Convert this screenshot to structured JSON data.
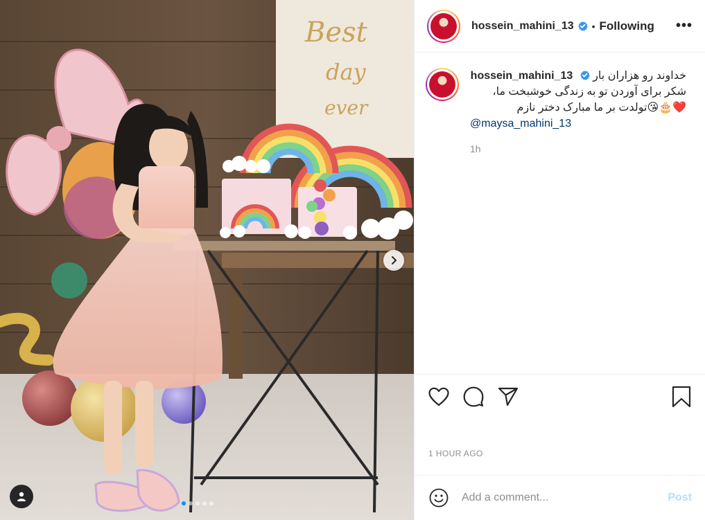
{
  "post": {
    "username": "hossein_mahini_13",
    "follow_status": "Following",
    "separator": "•",
    "more_label": "•••",
    "caption_lines": [
      "خداوند رو هزاران بار",
      "شکر برای آوردن تو به زندگی خوشبخت ما،",
      "❤️🎂😘تولدت بر ما مبارک دختر نازم"
    ],
    "mention": "@maysa_mahini_13",
    "relative_time": "1h",
    "timestamp": "1 HOUR AGO"
  },
  "photo": {
    "banner_text": "the Best day ever",
    "carousel_dots": 5,
    "active_dot": 0
  },
  "actions": {
    "like_icon": "heart-icon",
    "comment_icon": "comment-icon",
    "share_icon": "paper-plane-icon",
    "save_icon": "bookmark-icon"
  },
  "comment": {
    "placeholder": "Add a comment...",
    "post_label": "Post"
  },
  "colors": {
    "verified": "#3897f0",
    "post_disabled": "#b2dffc",
    "mention": "#00376b",
    "muted": "#8e8e8e"
  }
}
